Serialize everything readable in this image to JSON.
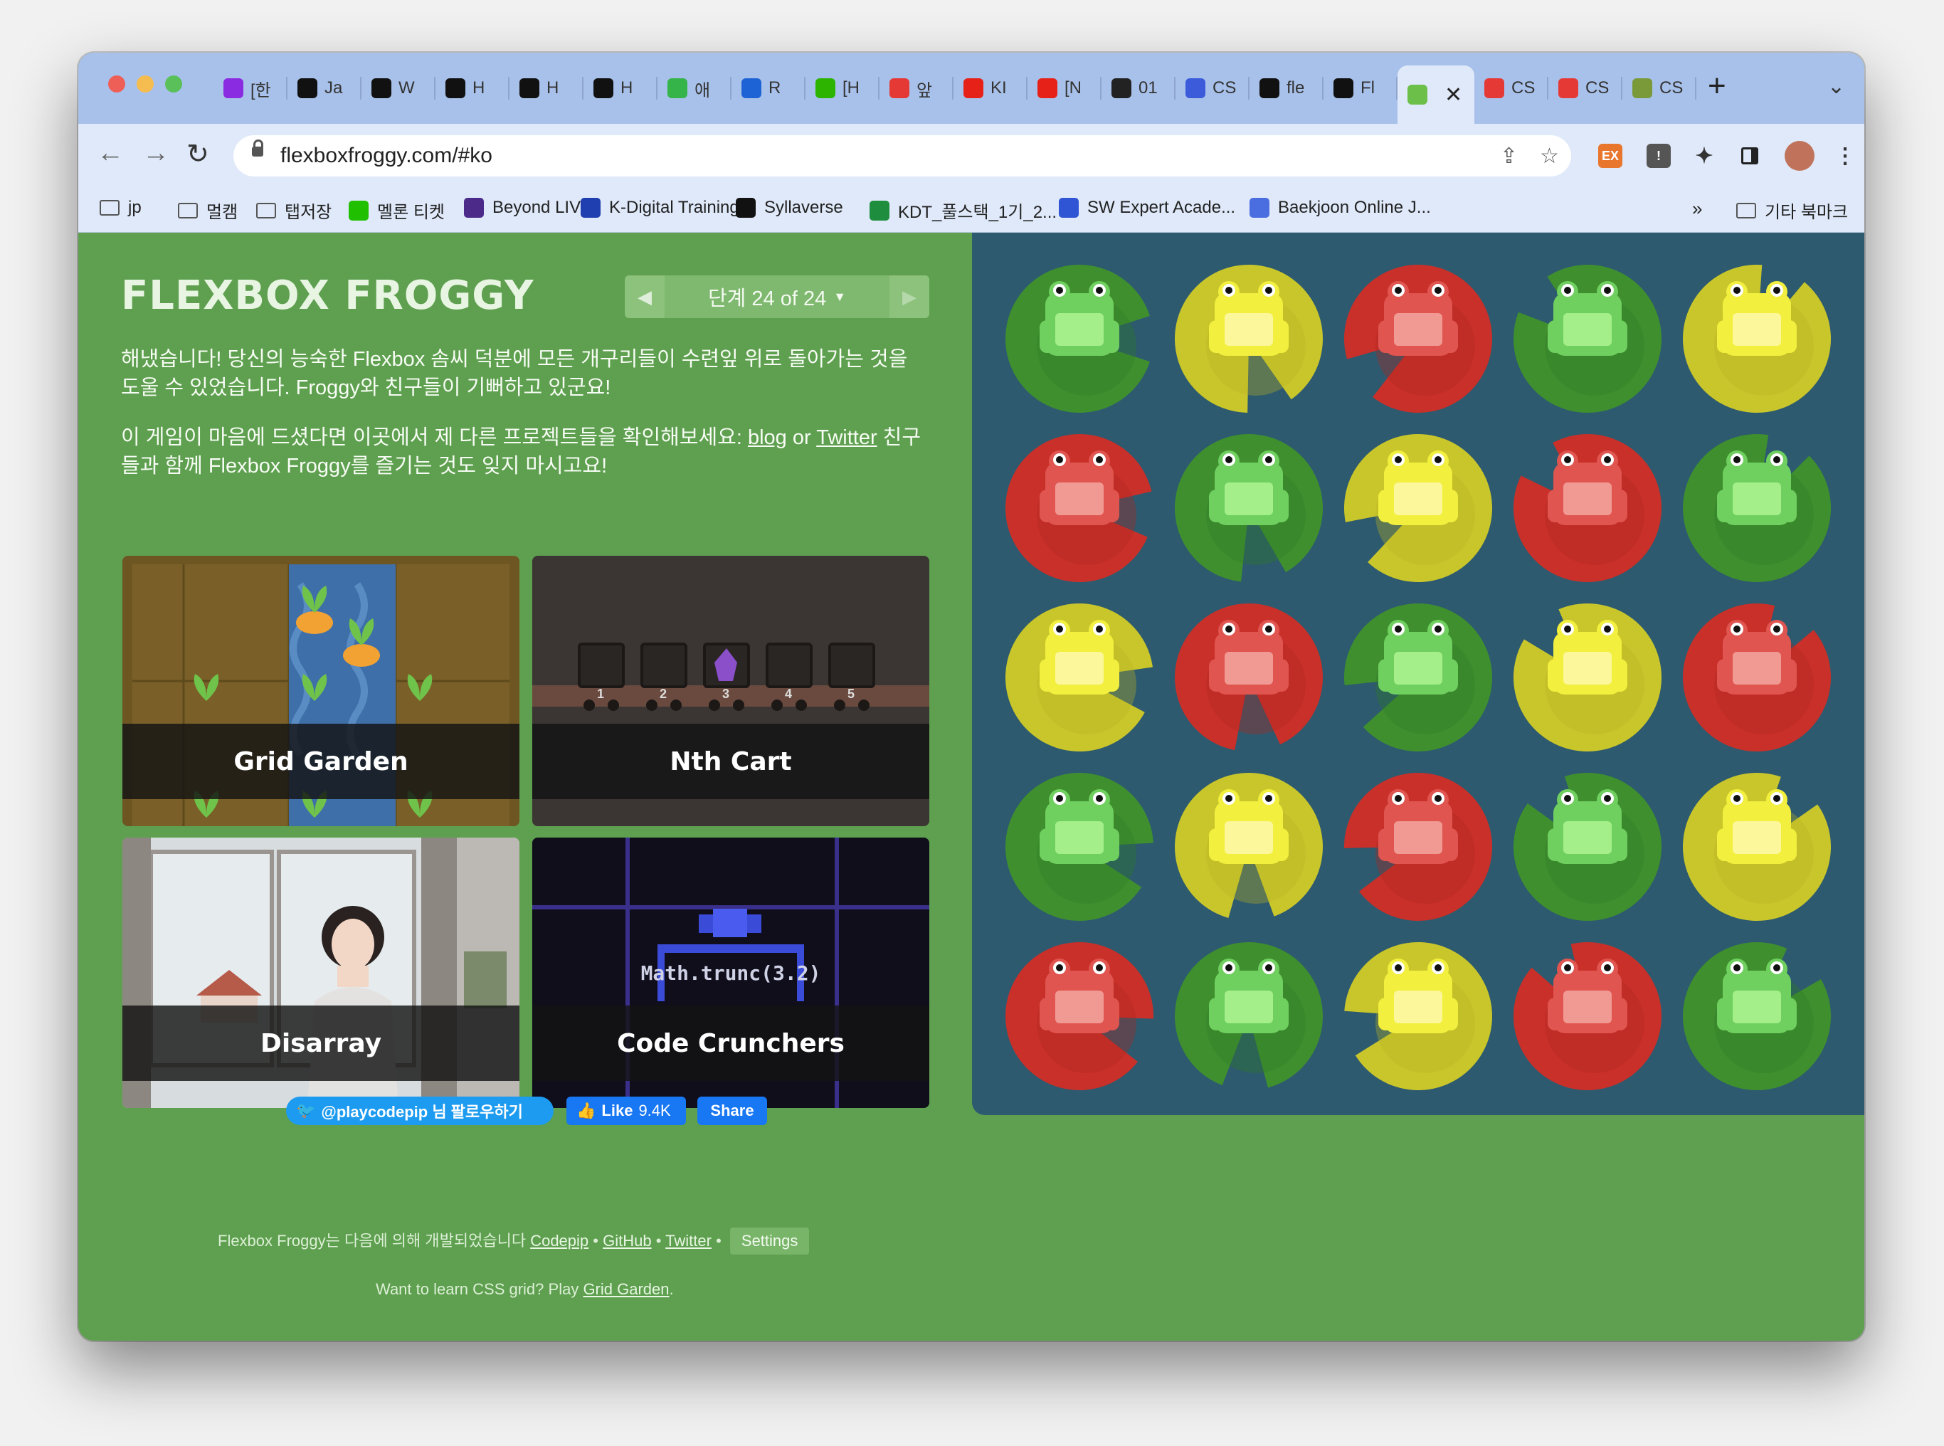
{
  "browser": {
    "tabs": [
      {
        "label": "[한",
        "icon": "purple-u-icon",
        "color": "#8a2be2"
      },
      {
        "label": "Ja",
        "icon": "codepen-icon",
        "color": "#111111"
      },
      {
        "label": "W",
        "icon": "notion-icon",
        "color": "#111111"
      },
      {
        "label": "H",
        "icon": "velog-m-icon",
        "color": "#111111"
      },
      {
        "label": "H",
        "icon": "velog-m-icon",
        "color": "#111111"
      },
      {
        "label": "H",
        "icon": "velog-m-icon",
        "color": "#111111"
      },
      {
        "label": "애",
        "icon": "blog-icon",
        "color": "#35b44a"
      },
      {
        "label": "R",
        "icon": "hi-icon",
        "color": "#1e63d6"
      },
      {
        "label": "[H",
        "icon": "chat-icon",
        "color": "#2db400"
      },
      {
        "label": "앞",
        "icon": "colorful-icon",
        "color": "#e53935"
      },
      {
        "label": "KI",
        "icon": "youtube-icon",
        "color": "#e62117"
      },
      {
        "label": "[N",
        "icon": "youtube-icon",
        "color": "#e62117"
      },
      {
        "label": "01",
        "icon": "github-icon",
        "color": "#222222"
      },
      {
        "label": "CS",
        "icon": "arrow-icon",
        "color": "#3b5bdb"
      },
      {
        "label": "fle",
        "icon": "velog-m-icon",
        "color": "#111111"
      },
      {
        "label": "Fl",
        "icon": "velog-m-icon",
        "color": "#111111"
      },
      {
        "label": "",
        "icon": "frog-icon",
        "color": "#6cc04a",
        "active": true
      },
      {
        "label": "CS",
        "icon": "record-icon",
        "color": "#e53935"
      },
      {
        "label": "CS",
        "icon": "record-icon",
        "color": "#e53935"
      },
      {
        "label": "CS",
        "icon": "plant-icon",
        "color": "#7a9a3a"
      }
    ],
    "url": "flexboxfroggy.com/#ko",
    "bookmarks": [
      {
        "label": "jp",
        "type": "folder"
      },
      {
        "label": "멀캠",
        "type": "folder"
      },
      {
        "label": "탭저장",
        "type": "folder"
      },
      {
        "label": "멜론 티켓",
        "type": "site",
        "color": "#20c000"
      },
      {
        "label": "Beyond LIVE",
        "type": "site",
        "color": "#4b2a8a"
      },
      {
        "label": "K-Digital Training",
        "type": "site",
        "color": "#1f3fb0"
      },
      {
        "label": "Syllaverse",
        "type": "site",
        "color": "#111111"
      },
      {
        "label": "KDT_풀스택_1기_2...",
        "type": "site",
        "color": "#1e8e3e"
      },
      {
        "label": "SW Expert Acade...",
        "type": "site",
        "color": "#2f55d4"
      },
      {
        "label": "Baekjoon Online J...",
        "type": "site",
        "color": "#4a6ee0"
      }
    ],
    "bookmarks_overflow": "»",
    "other_bookmarks": "기타 북마크"
  },
  "game": {
    "logo": "FLEXBOX FROGGY",
    "level_label": "단계 24 of 24",
    "paragraph1": "해냈습니다! 당신의 능숙한 Flexbox 솜씨 덕분에 모든 개구리들이 수련잎 위로 돌아가는 것을 도울 수 있었습니다. Froggy와 친구들이 기뻐하고 있군요!",
    "paragraph2_prefix": "이 게임이 마음에 드셨다면 이곳에서 제 다른 프로젝트들을 확인해보세요: ",
    "blog_link": "blog",
    "or_text": " or ",
    "twitter_link": "Twitter",
    "paragraph2_suffix": " 친구들과 함께 Flexbox Froggy를 즐기는 것도 잊지 마시고요!",
    "cards": [
      {
        "label": "Grid Garden"
      },
      {
        "label": "Nth Cart",
        "cart_numbers": [
          "1",
          "2",
          "3",
          "4",
          "5"
        ]
      },
      {
        "label": "Disarray"
      },
      {
        "label": "Code Crunchers",
        "code": "Math.trunc(3.2)"
      }
    ],
    "social": {
      "follow": "@playcodepip 님 팔로우하기",
      "like": "Like",
      "like_count": "9.4K",
      "share": "Share"
    },
    "footer": {
      "credit_prefix": "Flexbox Froggy는 다음에 의해 개발되었습니다",
      "codepip": "Codepip",
      "github": "GitHub",
      "twitter": "Twitter",
      "bullet": "•",
      "settings": "Settings",
      "grid_prefix": "Want to learn CSS grid? Play ",
      "grid_link": "Grid Garden",
      "grid_suffix": "."
    }
  },
  "pond": {
    "colors": {
      "green": {
        "pad": "#3f8f2f",
        "pad_dark": "#2f7a24",
        "frog": "#6fcf5f",
        "belly": "#a4ef8a"
      },
      "yellow": {
        "pad": "#c9c62c",
        "pad_dark": "#b6b321",
        "frog": "#f2ef3e",
        "belly": "#fbf79a"
      },
      "red": {
        "pad": "#c9302a",
        "pad_dark": "#b02620",
        "frog": "#e05550",
        "belly": "#f09a93"
      }
    },
    "grid": [
      [
        "green",
        "yellow",
        "red",
        "green",
        "yellow"
      ],
      [
        "red",
        "green",
        "yellow",
        "red",
        "green"
      ],
      [
        "yellow",
        "red",
        "green",
        "yellow",
        "red"
      ],
      [
        "green",
        "yellow",
        "red",
        "green",
        "yellow"
      ],
      [
        "red",
        "green",
        "yellow",
        "red",
        "green"
      ]
    ]
  }
}
